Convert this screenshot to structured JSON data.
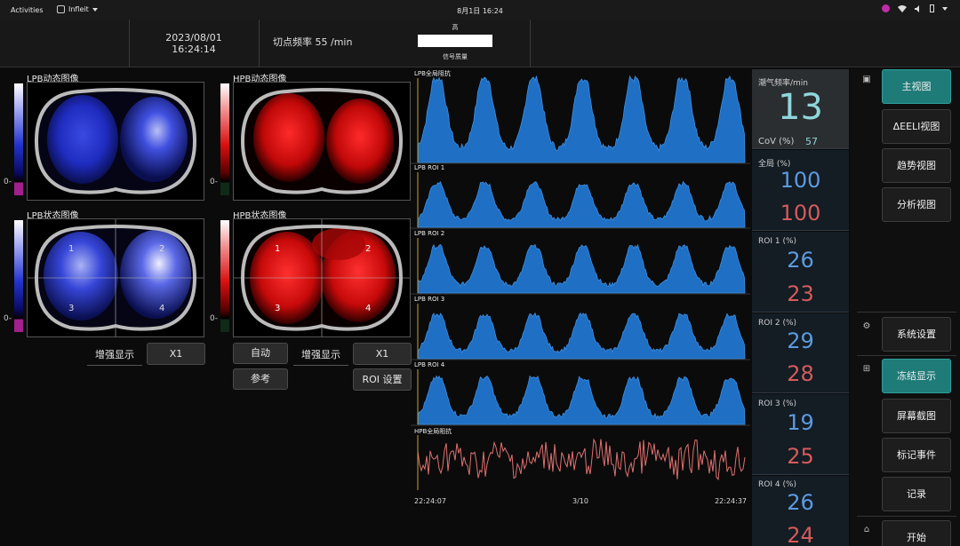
{
  "topbar": {
    "activities": "Activities",
    "app_name": "Infleit",
    "clock": "8月1日  16:24"
  },
  "header": {
    "date": "2023/08/01",
    "time": "16:24:14",
    "rate_label": "切点频率  55 /min",
    "signal_level": "高",
    "signal_label": "信号质量"
  },
  "images": {
    "lpb_dynamic": "LPB动态图像",
    "hpb_dynamic": "HPB动态图像",
    "lpb_status": "LPB状态图像",
    "hpb_status": "HPB状态图像",
    "zero": "0-",
    "roi_numbers": [
      "1",
      "2",
      "3",
      "4"
    ]
  },
  "controls": {
    "enhance": "增强显示",
    "x1": "X1",
    "auto": "自动",
    "reference": "参考",
    "roi_settings": "ROI 设置"
  },
  "waves": {
    "labels": [
      "LPB全局阻抗",
      "LPB ROI 1",
      "LPB ROI 2",
      "LPB ROI 3",
      "LPB ROI 4",
      "HPB全局阻抗"
    ],
    "time_start": "22:24:07",
    "page": "3/10",
    "time_end": "22:24:37"
  },
  "metrics": {
    "resp_label": "潮气频率/min",
    "resp_value": "13",
    "cov_label": "CoV (%)",
    "cov_value": "57",
    "global_label": "全局 (%)",
    "global_lpb": "100",
    "global_hpb": "100",
    "roi1_label": "ROI 1 (%)",
    "roi1_lpb": "26",
    "roi1_hpb": "23",
    "roi2_label": "ROI 2 (%)",
    "roi2_lpb": "29",
    "roi2_hpb": "28",
    "roi3_label": "ROI 3 (%)",
    "roi3_lpb": "19",
    "roi3_hpb": "25",
    "roi4_label": "ROI 4 (%)",
    "roi4_lpb": "26",
    "roi4_hpb": "24",
    "colors": {
      "lpb": "#5b9be0",
      "hpb": "#d45b5b",
      "accent": "#1f7b78"
    }
  },
  "nav": {
    "main_view": "主视图",
    "eeli_view": "ΔEELI视图",
    "trend_view": "趋势视图",
    "analysis_view": "分析视图",
    "system_settings": "系统设置",
    "freeze": "冻结显示",
    "screenshot": "屏幕截图",
    "mark_event": "标记事件",
    "record": "记录",
    "start": "开始",
    "icons": [
      "window-icon",
      "gear-icon",
      "grid-icon",
      "home-icon"
    ]
  }
}
